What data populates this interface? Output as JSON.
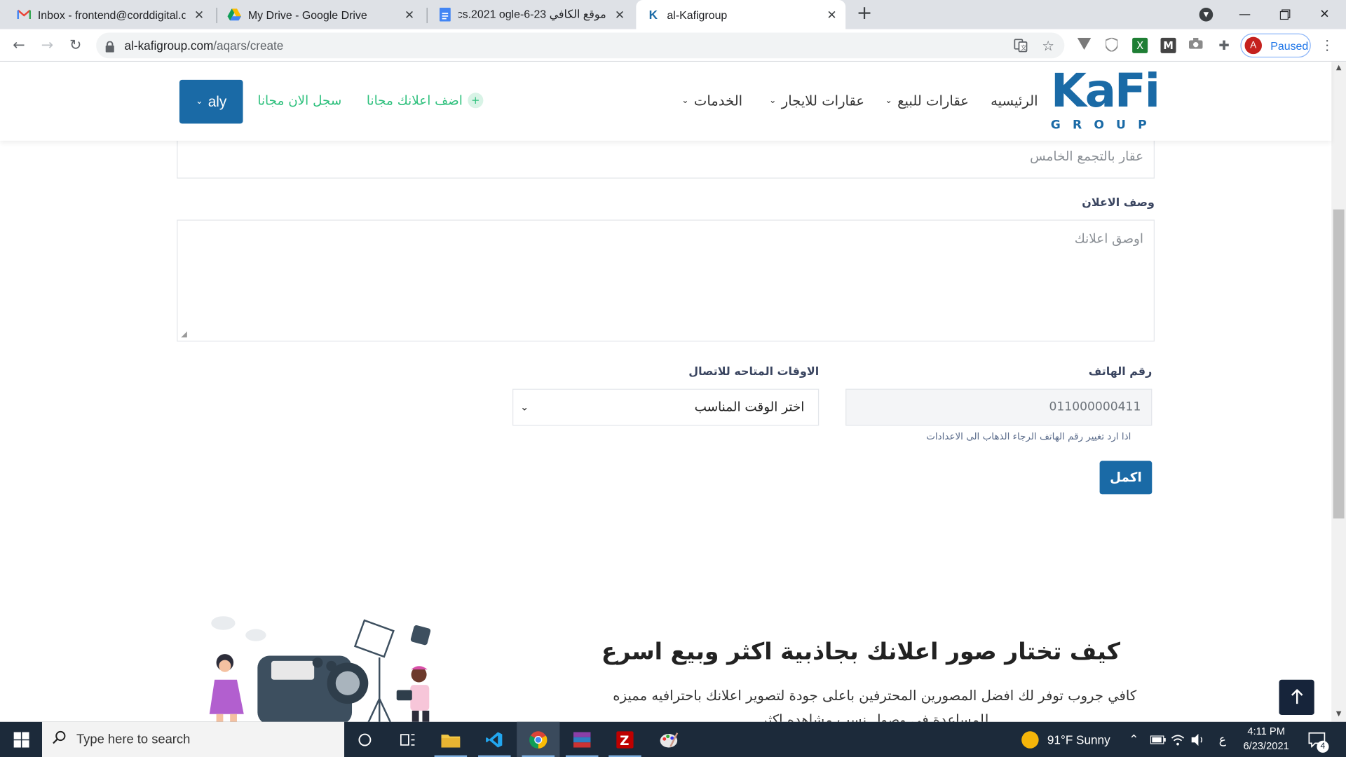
{
  "browser": {
    "tabs": [
      {
        "title": "Inbox - frontend@corddigital.com",
        "icon": "gmail-icon"
      },
      {
        "title": "My Drive - Google Drive",
        "icon": "google-drive-icon"
      },
      {
        "title": "موقع الكافي 23-6-Docs.2021 ogle",
        "icon": "google-docs-icon"
      },
      {
        "title": "al-Kafigroup",
        "icon": "kafi-icon"
      }
    ],
    "url_host": "al-kafigroup.com",
    "url_path": "/aqars/create",
    "profile_initial": "A",
    "profile_status": "Paused"
  },
  "site": {
    "logo_main": "KaFi",
    "logo_sub": "GROUP",
    "nav": {
      "home": "الرئيسيه",
      "sale": "عقارات للبيع",
      "rent": "عقارات للايجار",
      "services": "الخدمات"
    },
    "add_ad": "اضف اعلانك مجانا",
    "register": "سجل الان مجانا",
    "user_name": "aly"
  },
  "form": {
    "title_value": "عقار بالتجمع الخامس",
    "desc_label": "وصف الاعلان",
    "desc_placeholder": "اوصق اعلانك",
    "phone_label": "رقم الهاتف",
    "phone_value": "011000000411",
    "phone_hint": "اذا ارد تغيير رقم الهاتف الرجاء الذهاب الى الاعدادات",
    "time_label": "الاوقات المتاحه للاتصال",
    "time_selected": "اختر الوقت المناسب",
    "submit_label": "اكمل"
  },
  "promo": {
    "title": "كيف تختار صور اعلانك بجاذبية اكثر وبيع اسرع",
    "text": "كافي جروب توفر لك افضل المصورين المحترفين باعلى جودة لتصوير اعلانك باحترافيه مميزه للمساعدة في وصول نسب مشاهده اكثر"
  },
  "taskbar": {
    "search_placeholder": "Type here to search",
    "weather": "91°F  Sunny",
    "lang": "ع",
    "time": "4:11 PM",
    "date": "6/23/2021",
    "notifications": "4"
  },
  "colors": {
    "brand_blue": "#1a6aa6",
    "accent_green": "#2ec07d",
    "dark_navy": "#16243a"
  }
}
